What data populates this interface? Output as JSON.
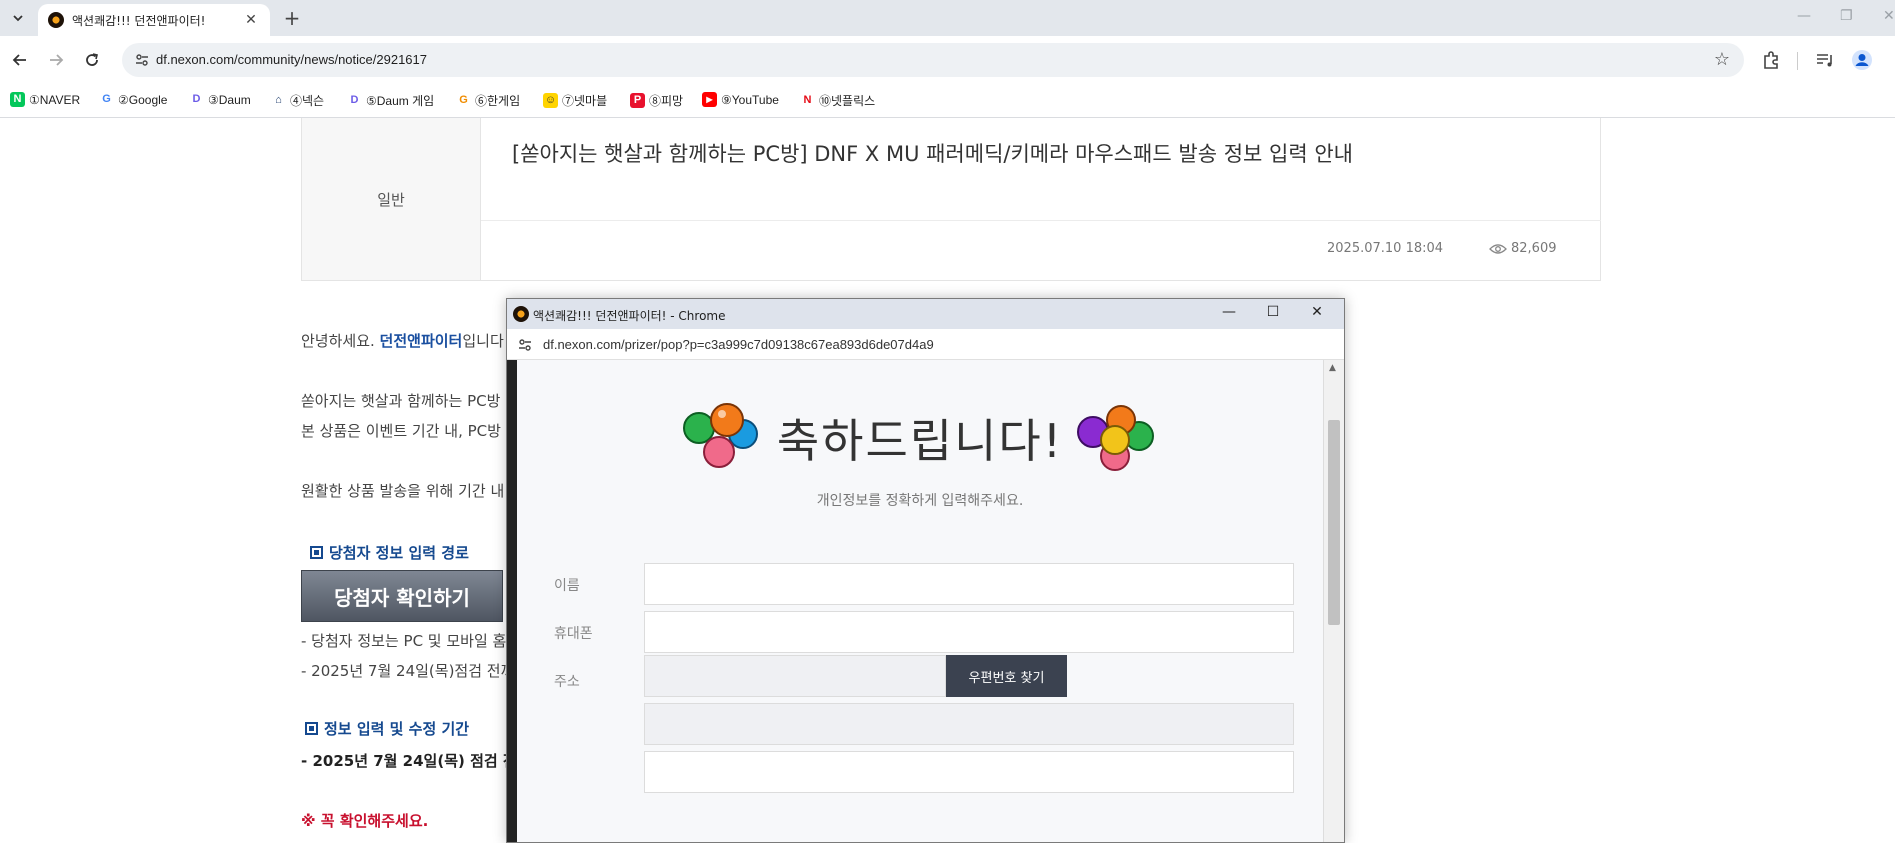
{
  "browser": {
    "tab_title": "액션쾌감!!! 던전앤파이터!",
    "tab_close": "✕",
    "new_tab": "+",
    "url": "df.nexon.com/community/news/notice/2921617",
    "bookmarks": [
      {
        "label": "①NAVER",
        "icon": "naver-icon",
        "color": "#03c75a",
        "glyph": "N"
      },
      {
        "label": "②Google",
        "icon": "google-icon",
        "color": "#4285f4",
        "glyph": "G"
      },
      {
        "label": "③Daum",
        "icon": "daum-icon",
        "color": "#6c5ce7",
        "glyph": "D"
      },
      {
        "label": "④넥슨",
        "icon": "nexon-icon",
        "color": "#1b3a6b",
        "glyph": "N"
      },
      {
        "label": "⑤Daum 게임",
        "icon": "daum-game-icon",
        "color": "#6c5ce7",
        "glyph": "D"
      },
      {
        "label": "⑥한게임",
        "icon": "hangame-icon",
        "color": "#f08c00",
        "glyph": "G"
      },
      {
        "label": "⑦넷마블",
        "icon": "netmarble-icon",
        "color": "#ffd400",
        "glyph": "☺"
      },
      {
        "label": "⑧피망",
        "icon": "pmang-icon",
        "color": "#e8112d",
        "glyph": "P"
      },
      {
        "label": "⑨YouTube",
        "icon": "youtube-icon",
        "color": "#ff0000",
        "glyph": "▶"
      },
      {
        "label": "⑩넷플릭스",
        "icon": "netflix-icon",
        "color": "#e50914",
        "glyph": "N"
      }
    ]
  },
  "notice": {
    "category": "일반",
    "title": "[쏟아지는 햇살과 함께하는 PC방] DNF X MU 패러메딕/키메라 마우스패드 발송 정보 입력 안내",
    "date": "2025.07.10 18:04",
    "views": "82,609"
  },
  "body": {
    "greeting_prefix": "안녕하세요. ",
    "greeting_brand": "던전앤파이터",
    "greeting_suffix": "입니다",
    "line2": "쏟아지는 햇살과 함께하는 PC방",
    "line3": "본 상품은 이벤트 기간 내, PC방",
    "line4": "원활한 상품 발송을 위해 기간 내",
    "section1": "당첨자 정보 입력 경로",
    "winner_button": "당첨자 확인하기",
    "line5": "- 당첨자 정보는 PC 및 모바일 홈",
    "line6": "- 2025년 7월 24일(목)점검 전까",
    "section2": "정보 입력 및 수정 기간",
    "line7": "- 2025년 7월 24일(목) 점검 전",
    "warning": "※ 꼭 확인해주세요."
  },
  "popup": {
    "window_title": "액션쾌감!!! 던전앤파이터! - Chrome",
    "url": "df.nexon.com/prizer/pop?p=c3a999c7d09138c67ea893d6de07d4a9",
    "heading": "축하드립니다!",
    "subtitle": "개인정보를 정확하게 입력해주세요.",
    "labels": {
      "name": "이름",
      "phone": "휴대폰",
      "address": "주소"
    },
    "zip_button": "우편번호 찾기"
  }
}
